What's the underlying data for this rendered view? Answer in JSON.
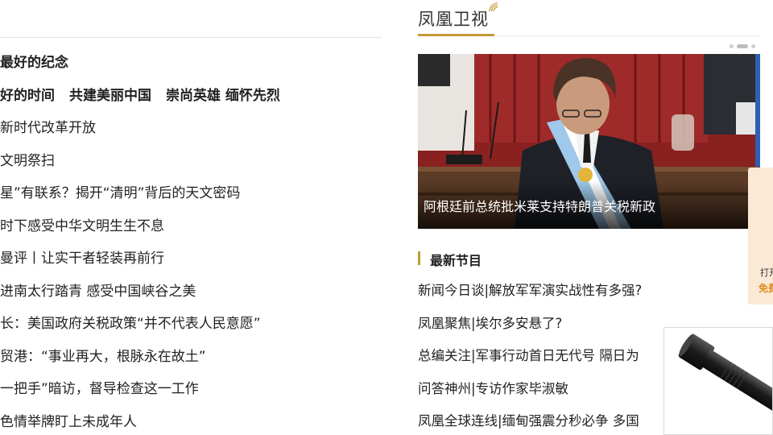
{
  "left_list": {
    "items": [
      {
        "segments": [
          "最好的纪念"
        ],
        "bold": true
      },
      {
        "segments": [
          "好的时间",
          "共建美丽中国",
          "崇尚英雄 缅怀先烈"
        ],
        "bold": true
      },
      {
        "segments": [
          "新时代改革开放"
        ],
        "bold": false
      },
      {
        "segments": [
          "文明祭扫"
        ],
        "bold": false
      },
      {
        "segments": [
          "星”有联系？揭开“清明”背后的天文密码"
        ],
        "bold": false
      },
      {
        "segments": [
          "时下感受中华文明生生不息"
        ],
        "bold": false
      },
      {
        "segments": [
          "曼评丨让实干者轻装再前行"
        ],
        "bold": false
      },
      {
        "segments": [
          "进南太行踏青 感受中国峡谷之美"
        ],
        "bold": false
      },
      {
        "segments": [
          "长：美国政府关税政策“并不代表人民意愿”"
        ],
        "bold": false
      },
      {
        "segments": [
          "贸港：“事业再大，根脉永在故土”"
        ],
        "bold": false
      },
      {
        "segments": [
          "一把手”暗访，督导检查这一工作"
        ],
        "bold": false
      },
      {
        "segments": [
          "色情举牌盯上未成年人"
        ],
        "bold": false
      }
    ]
  },
  "section": {
    "title": "凤凰卫视",
    "accent": "#c49a3a"
  },
  "hero": {
    "caption": "阿根廷前总统批米莱支持特朗普关税新政"
  },
  "latest": {
    "title": "最新节目",
    "items": [
      "新闻今日谈|解放军军演实战性有多强?",
      "凤凰聚焦|埃尔多安悬了?",
      "总编关注|军事行动首日无代号 隔日为",
      "问答神州|专访作家毕淑敏",
      "凤凰全球连线|缅甸强震分秒必争 多国"
    ]
  },
  "side_ad": {
    "line1": "打开",
    "line2": "免费"
  }
}
